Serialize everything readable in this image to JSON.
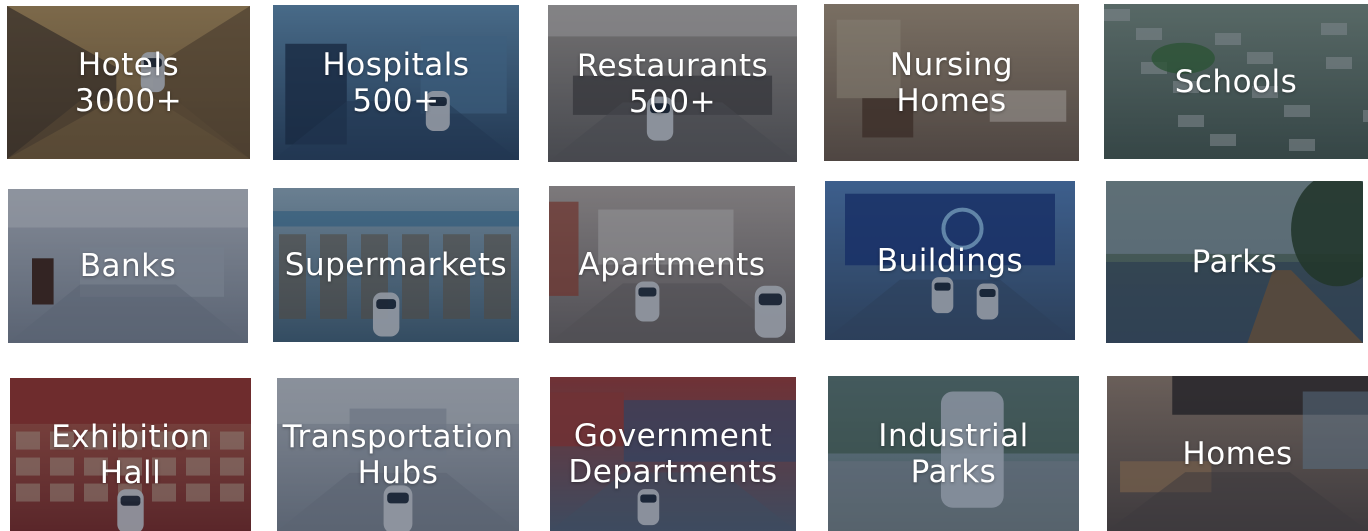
{
  "tiles": [
    {
      "name": "tile-hotels",
      "lines": [
        "Hotels",
        "3000+"
      ],
      "scene": "hotel-corridor",
      "base": "#8a6a3a",
      "accent": "#c9a15e"
    },
    {
      "name": "tile-hospitals",
      "lines": [
        "Hospitals",
        "500+"
      ],
      "scene": "hospital-hall",
      "base": "#2d4b6b",
      "accent": "#6fa3c8"
    },
    {
      "name": "tile-restaurants",
      "lines": [
        "Restaurants",
        "500+"
      ],
      "scene": "restaurant",
      "base": "#6e6a66",
      "accent": "#b8aea2"
    },
    {
      "name": "tile-nursing-homes",
      "lines": [
        "Nursing",
        "Homes"
      ],
      "scene": "nursing-room",
      "base": "#7a6450",
      "accent": "#c4ab88"
    },
    {
      "name": "tile-schools",
      "lines": [
        "Schools"
      ],
      "scene": "school-aerial",
      "base": "#4f6457",
      "accent": "#8aa08e"
    },
    {
      "name": "tile-banks",
      "lines": [
        "Banks"
      ],
      "scene": "bank-lobby",
      "base": "#8e97a4",
      "accent": "#d6dbe2"
    },
    {
      "name": "tile-supermarkets",
      "lines": [
        "Supermarkets"
      ],
      "scene": "supermarket",
      "base": "#4c6f86",
      "accent": "#a9c7d8"
    },
    {
      "name": "tile-apartments",
      "lines": [
        "Apartments"
      ],
      "scene": "apartment-lobby",
      "base": "#7d7470",
      "accent": "#c9bcb2"
    },
    {
      "name": "tile-buildings",
      "lines": [
        "Buildings"
      ],
      "scene": "building-lobby",
      "base": "#3f5a7a",
      "accent": "#5c8fd0"
    },
    {
      "name": "tile-parks",
      "lines": [
        "Parks"
      ],
      "scene": "park-lake",
      "base": "#506a78",
      "accent": "#7e9a6e"
    },
    {
      "name": "tile-exhibition-hall",
      "lines": [
        "Exhibition",
        "Hall"
      ],
      "scene": "exhibition",
      "base": "#8e2e26",
      "accent": "#d06a52"
    },
    {
      "name": "tile-transportation-hubs",
      "lines": [
        "Transportation",
        "Hubs"
      ],
      "scene": "transport-hub",
      "base": "#8f98a3",
      "accent": "#d3d8de"
    },
    {
      "name": "tile-government-departments",
      "lines": [
        "Government",
        "Departments"
      ],
      "scene": "government",
      "base": "#5d6d82",
      "accent": "#b3413a"
    },
    {
      "name": "tile-industrial-parks",
      "lines": [
        "Industrial",
        "Parks"
      ],
      "scene": "industrial-park",
      "base": "#5d7766",
      "accent": "#a9c3de"
    },
    {
      "name": "tile-homes",
      "lines": [
        "Homes"
      ],
      "scene": "home-interior",
      "base": "#5d5048",
      "accent": "#a98f78"
    }
  ]
}
